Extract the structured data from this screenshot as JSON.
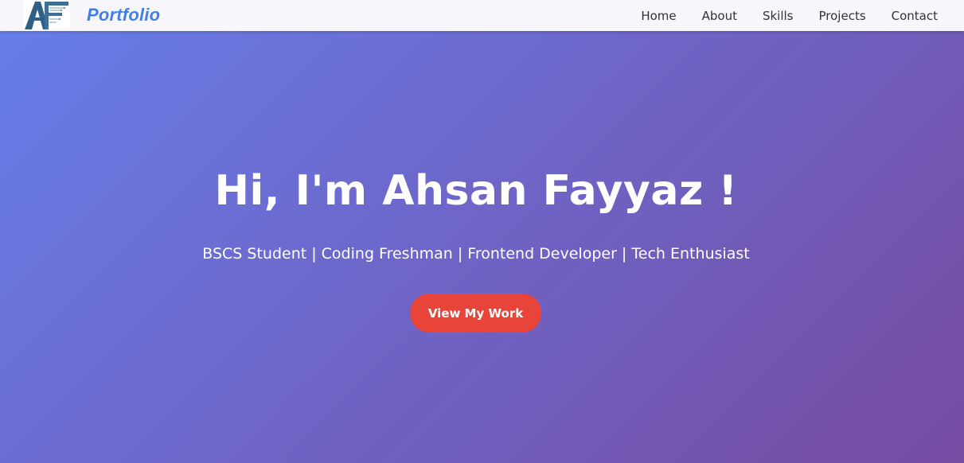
{
  "nav": {
    "brand": "Portfolio",
    "logo_text": "AF",
    "links": [
      "Home",
      "About",
      "Skills",
      "Projects",
      "Contact"
    ]
  },
  "hero": {
    "title": "Hi, I'm Ahsan Fayyaz !",
    "subtitle": "BSCS Student | Coding Freshman | Frontend Developer | Tech Enthusiast",
    "cta_label": "View My Work"
  },
  "colors": {
    "gradient_start": "#667eea",
    "gradient_end": "#764ba2",
    "brand": "#3f7fe6",
    "cta": "#e8443a",
    "navbar": "#f6f6fb"
  }
}
